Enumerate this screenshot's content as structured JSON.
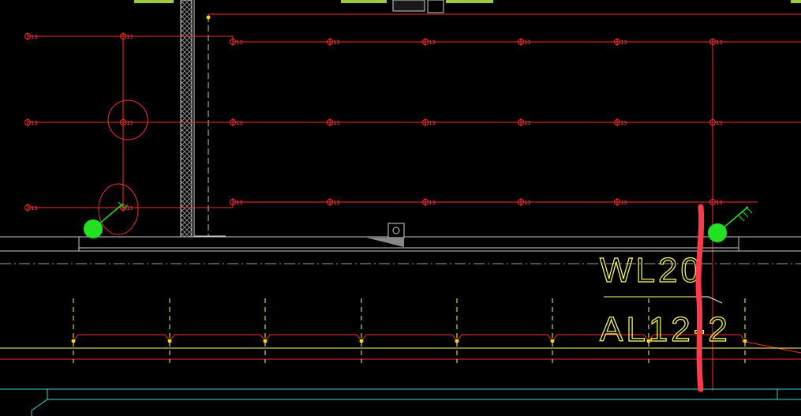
{
  "drawing": {
    "background": "#000000",
    "colors": {
      "circuit_red": "#ff2a2a",
      "annotation_red": "#ff3b4a",
      "text_yellow": "#ffff66",
      "beam_white": "#c8c8c8",
      "slab_cyan": "#38d7d7",
      "marker_green": "#22e022",
      "junction_yellow": "#ffd400"
    },
    "fixture_symbol": "Φ",
    "fixture_subscript": "13",
    "circuit_tags": {
      "upper": "WL20",
      "lower": "AL12-2"
    },
    "icons": [
      "lighting-fixture-icon",
      "junction-box-icon",
      "green-marker-icon",
      "leader-arrow-icon",
      "hatched-wall-icon",
      "section-marker-icon"
    ],
    "annotation": "red-vertical-highlight-stroke"
  }
}
